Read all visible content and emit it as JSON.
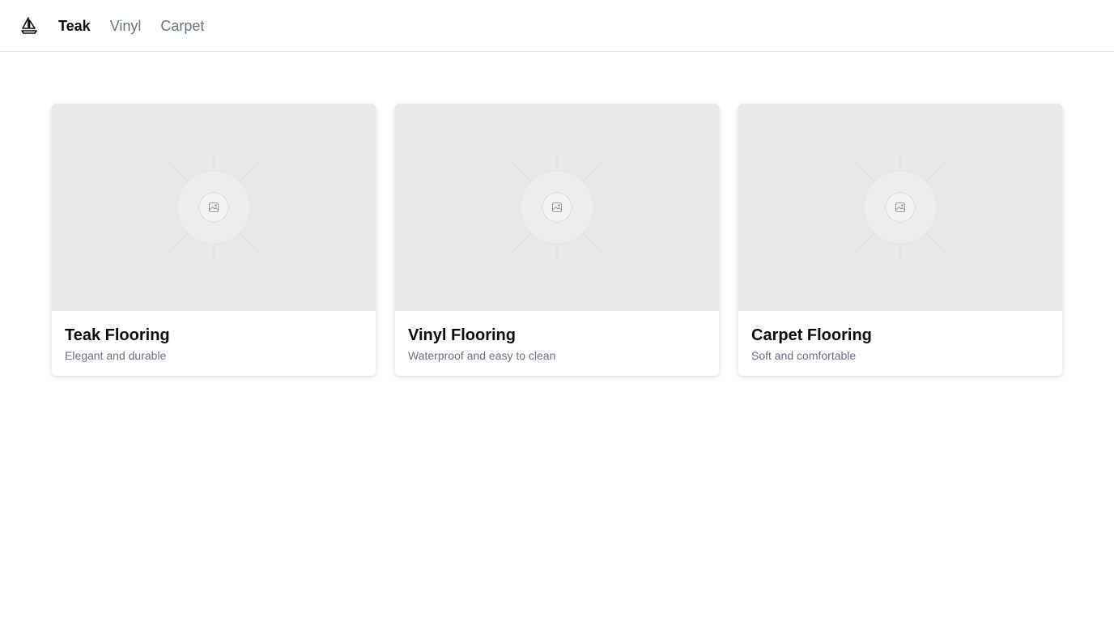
{
  "nav": {
    "logo_icon": "sailboat-icon",
    "links": [
      {
        "label": "Teak",
        "active": true
      },
      {
        "label": "Vinyl",
        "active": false
      },
      {
        "label": "Carpet",
        "active": false
      }
    ]
  },
  "cards": [
    {
      "title": "Teak Flooring",
      "description": "Elegant and durable",
      "image_icon": "image-placeholder-icon"
    },
    {
      "title": "Vinyl Flooring",
      "description": "Waterproof and easy to clean",
      "image_icon": "image-placeholder-icon"
    },
    {
      "title": "Carpet Flooring",
      "description": "Soft and comfortable",
      "image_icon": "image-placeholder-icon"
    }
  ],
  "colors": {
    "text_primary": "#0a0a0a",
    "text_muted": "#6b7280",
    "placeholder_bg": "#e8e8e8",
    "border": "#e8e8e8"
  }
}
